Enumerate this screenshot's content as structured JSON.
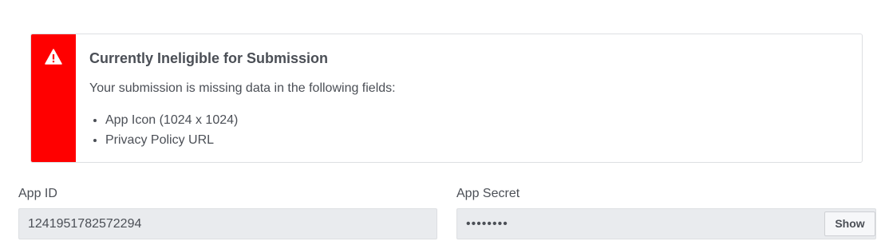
{
  "alert": {
    "icon": "warning-triangle-icon",
    "accent_color": "#ff0000",
    "title": "Currently Ineligible for Submission",
    "message": "Your submission is missing data in the following fields:",
    "missing_fields": [
      "App Icon (1024 x 1024)",
      "Privacy Policy URL"
    ]
  },
  "app_id": {
    "label": "App ID",
    "value": "1241951782572294"
  },
  "app_secret": {
    "label": "App Secret",
    "masked_value": "••••••••",
    "show_label": "Show"
  }
}
